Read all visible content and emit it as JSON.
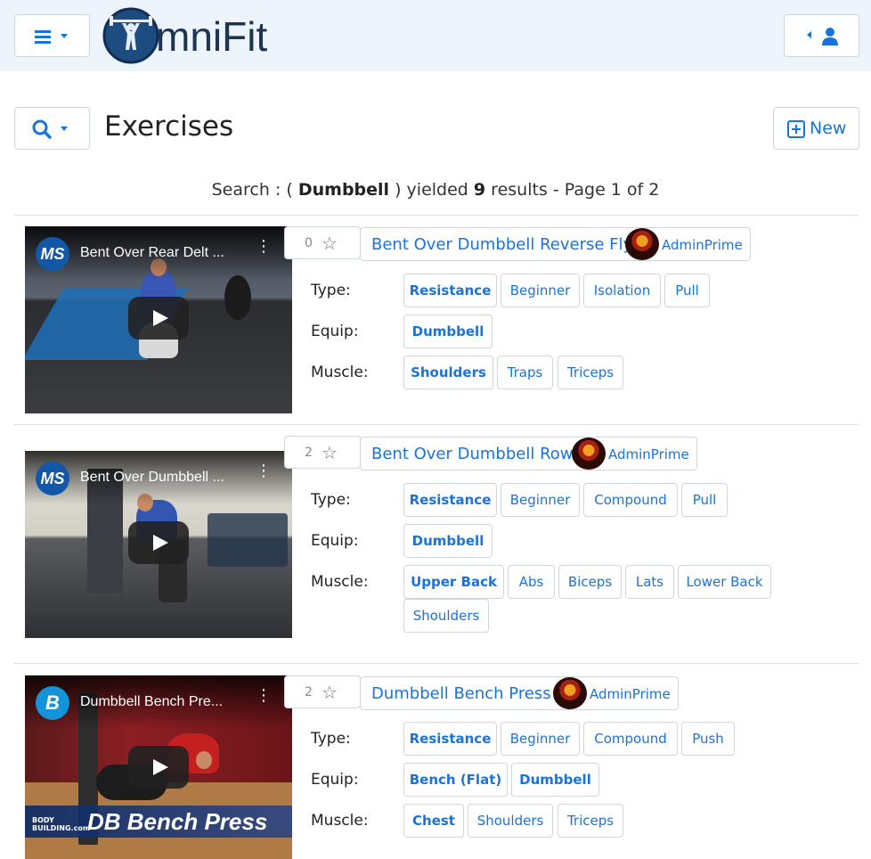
{
  "app": {
    "logo_text": "mniFit"
  },
  "header": {
    "menu_icon": "bars-icon",
    "user_icon": "user-icon"
  },
  "page": {
    "title": "Exercises",
    "new_label": "New"
  },
  "summary": {
    "prefix": "Search : ( ",
    "term": "Dumbbell",
    "middle": " ) yielded ",
    "count": "9",
    "suffix": " results - Page 1 of 2"
  },
  "exercises": [
    {
      "name": "Bent Over Dumbbell Reverse Fly",
      "votes": "0",
      "author": "AdminPrime",
      "video_title": "Bent Over Rear Delt ...",
      "channel": "MS",
      "type_label": "Type:",
      "equip_label": "Equip:",
      "muscle_label": "Muscle:",
      "types": [
        "Resistance",
        "Beginner",
        "Isolation",
        "Pull"
      ],
      "equip": [
        "Dumbbell"
      ],
      "muscles": [
        "Shoulders",
        "Traps",
        "Triceps"
      ]
    },
    {
      "name": "Bent Over Dumbbell Row",
      "votes": "2",
      "author": "AdminPrime",
      "video_title": "Bent Over Dumbbell ...",
      "channel": "MS",
      "type_label": "Type:",
      "equip_label": "Equip:",
      "muscle_label": "Muscle:",
      "types": [
        "Resistance",
        "Beginner",
        "Compound",
        "Pull"
      ],
      "equip": [
        "Dumbbell"
      ],
      "muscles": [
        "Upper Back",
        "Abs",
        "Biceps",
        "Lats",
        "Lower Back",
        "Shoulders"
      ]
    },
    {
      "name": "Dumbbell Bench Press",
      "votes": "2",
      "author": "AdminPrime",
      "video_title": "Dumbbell Bench Pre...",
      "channel": "B",
      "caption": "DB Bench Press",
      "caption_logo": "BODY BUILDING.com",
      "type_label": "Type:",
      "equip_label": "Equip:",
      "muscle_label": "Muscle:",
      "types": [
        "Resistance",
        "Beginner",
        "Compound",
        "Push"
      ],
      "equip": [
        "Bench (Flat)",
        "Dumbbell"
      ],
      "muscles": [
        "Chest",
        "Shoulders",
        "Triceps"
      ]
    }
  ],
  "colors": {
    "accent": "#1a73d9",
    "header_bg": "#eef4fb",
    "logo": "#1d3550"
  }
}
